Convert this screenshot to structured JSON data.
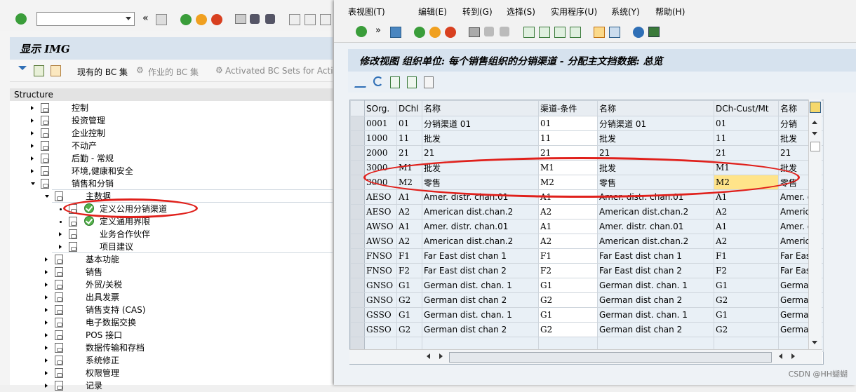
{
  "left_window": {
    "title_partial": "显示 IMG",
    "top_title_fragment": "显示 IMG",
    "bc_buttons": [
      "现有的 BC 集",
      "作业的 BC 集",
      "Activated BC Sets for Activit"
    ],
    "structure_header": "Structure",
    "tree": [
      {
        "label": "控制",
        "level": 1,
        "state": "collapsed"
      },
      {
        "label": "投资管理",
        "level": 1,
        "state": "collapsed"
      },
      {
        "label": "企业控制",
        "level": 1,
        "state": "collapsed"
      },
      {
        "label": "不动产",
        "level": 1,
        "state": "collapsed"
      },
      {
        "label": "后勤 - 常规",
        "level": 1,
        "state": "collapsed"
      },
      {
        "label": "环境,健康和安全",
        "level": 1,
        "state": "collapsed"
      },
      {
        "label": "销售和分销",
        "level": 1,
        "state": "expanded"
      },
      {
        "label": "主数据",
        "level": 2,
        "state": "expanded"
      },
      {
        "label": "定义公用分销渠道",
        "level": 3,
        "state": "leaf-exec"
      },
      {
        "label": "定义通用界限",
        "level": 3,
        "state": "leaf-exec"
      },
      {
        "label": "业务合作伙伴",
        "level": 3,
        "state": "collapsed"
      },
      {
        "label": "项目建议",
        "level": 3,
        "state": "collapsed"
      },
      {
        "label": "基本功能",
        "level": 2,
        "state": "collapsed"
      },
      {
        "label": "销售",
        "level": 2,
        "state": "collapsed"
      },
      {
        "label": "外贸/关税",
        "level": 2,
        "state": "collapsed"
      },
      {
        "label": "出具发票",
        "level": 2,
        "state": "collapsed"
      },
      {
        "label": "销售支持 (CAS)",
        "level": 2,
        "state": "collapsed"
      },
      {
        "label": "电子数据交换",
        "level": 2,
        "state": "collapsed"
      },
      {
        "label": "POS 接口",
        "level": 2,
        "state": "collapsed"
      },
      {
        "label": "数据传输和存档",
        "level": 2,
        "state": "collapsed"
      },
      {
        "label": "系统修正",
        "level": 2,
        "state": "collapsed"
      },
      {
        "label": "权限管理",
        "level": 2,
        "state": "collapsed"
      },
      {
        "label": "记录",
        "level": 2,
        "state": "collapsed"
      }
    ]
  },
  "right_window": {
    "menu": [
      "表视图(T)",
      "编辑(E)",
      "转到(G)",
      "选择(S)",
      "实用程序(U)",
      "系统(Y)",
      "帮助(H)"
    ],
    "title": "修改视图 组织单位: 每个销售组织的分销渠道 - 分配主文挡数据: 总览",
    "columns": [
      "SOrg.",
      "DChl",
      "名称",
      "渠道-条件",
      "名称",
      "DCh-Cust/Mt",
      "名称"
    ],
    "rows": [
      [
        "0001",
        "01",
        "分销渠道 01",
        "01",
        "分销渠道 01",
        "01",
        "分销"
      ],
      [
        "1000",
        "11",
        "批发",
        "11",
        "批发",
        "11",
        "批发"
      ],
      [
        "2000",
        "21",
        "21",
        "21",
        "21",
        "21",
        "21"
      ],
      [
        "3000",
        "M1",
        "批发",
        "M1",
        "批发",
        "M1",
        "批发"
      ],
      [
        "3000",
        "M2",
        "零售",
        "M2",
        "零售",
        "M2",
        "零售"
      ],
      [
        "AESO",
        "A1",
        "Amer. distr. chan.01",
        "A1",
        "Amer. distr. chan.01",
        "A1",
        "Amer. d"
      ],
      [
        "AESO",
        "A2",
        "American dist.chan.2",
        "A2",
        "American dist.chan.2",
        "A2",
        "Americ"
      ],
      [
        "AWSO",
        "A1",
        "Amer. distr. chan.01",
        "A1",
        "Amer. distr. chan.01",
        "A1",
        "Amer. d"
      ],
      [
        "AWSO",
        "A2",
        "American dist.chan.2",
        "A2",
        "American dist.chan.2",
        "A2",
        "Americ"
      ],
      [
        "FNSO",
        "F1",
        "Far East dist chan 1",
        "F1",
        "Far East dist chan 1",
        "F1",
        "Far Eas"
      ],
      [
        "FNSO",
        "F2",
        "Far East dist chan 2",
        "F2",
        "Far East dist chan 2",
        "F2",
        "Far Eas"
      ],
      [
        "GNSO",
        "G1",
        "German dist. chan. 1",
        "G1",
        "German dist. chan. 1",
        "G1",
        "German"
      ],
      [
        "GNSO",
        "G2",
        "German dist chan 2",
        "G2",
        "German dist chan 2",
        "G2",
        "German"
      ],
      [
        "GSSO",
        "G1",
        "German dist. chan. 1",
        "G1",
        "German dist. chan. 1",
        "G1",
        "German"
      ],
      [
        "GSSO",
        "G2",
        "German dist chan 2",
        "G2",
        "German dist chan 2",
        "G2",
        "German"
      ]
    ]
  },
  "watermark": "CSDN @HH蝴蝴",
  "colors": {
    "accent_red": "#e0201b",
    "title_bg": "#d6e2ee",
    "cell_focus": "#ffe48a"
  }
}
